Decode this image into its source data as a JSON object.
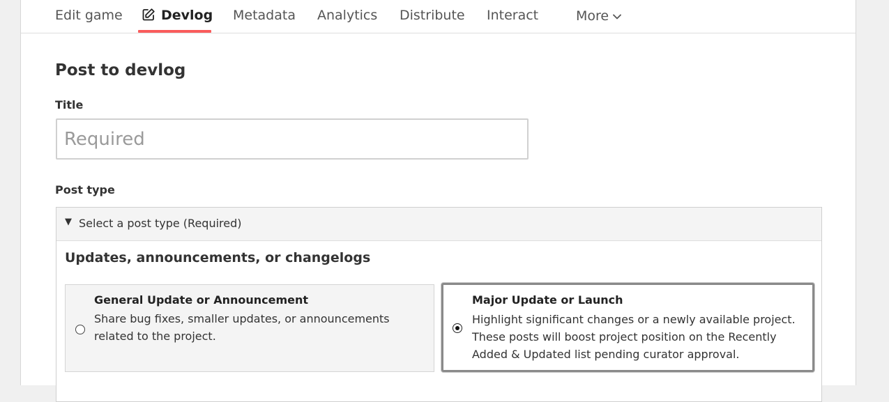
{
  "nav": {
    "tabs": [
      {
        "label": "Edit game"
      },
      {
        "label": "Devlog",
        "active": true,
        "icon": "edit-icon"
      },
      {
        "label": "Metadata"
      },
      {
        "label": "Analytics"
      },
      {
        "label": "Distribute"
      },
      {
        "label": "Interact"
      },
      {
        "label": "More",
        "icon": "chevron-down-icon"
      }
    ],
    "active_color": "#fa5c5c"
  },
  "form": {
    "heading": "Post to devlog",
    "title_label": "Title",
    "title_value": "",
    "title_placeholder": "Required",
    "post_type_label": "Post type",
    "post_type_summary": "Select a post type (Required)",
    "group_title": "Updates, announcements, or changelogs",
    "options": [
      {
        "title": "General Update or Announcement",
        "description": "Share bug fixes, smaller updates, or announcements related to the project.",
        "selected": false
      },
      {
        "title": "Major Update or Launch",
        "description": "Highlight significant changes or a newly available project. These posts will boost project position on the Recently Added & Updated list pending curator approval.",
        "selected": true
      }
    ]
  }
}
